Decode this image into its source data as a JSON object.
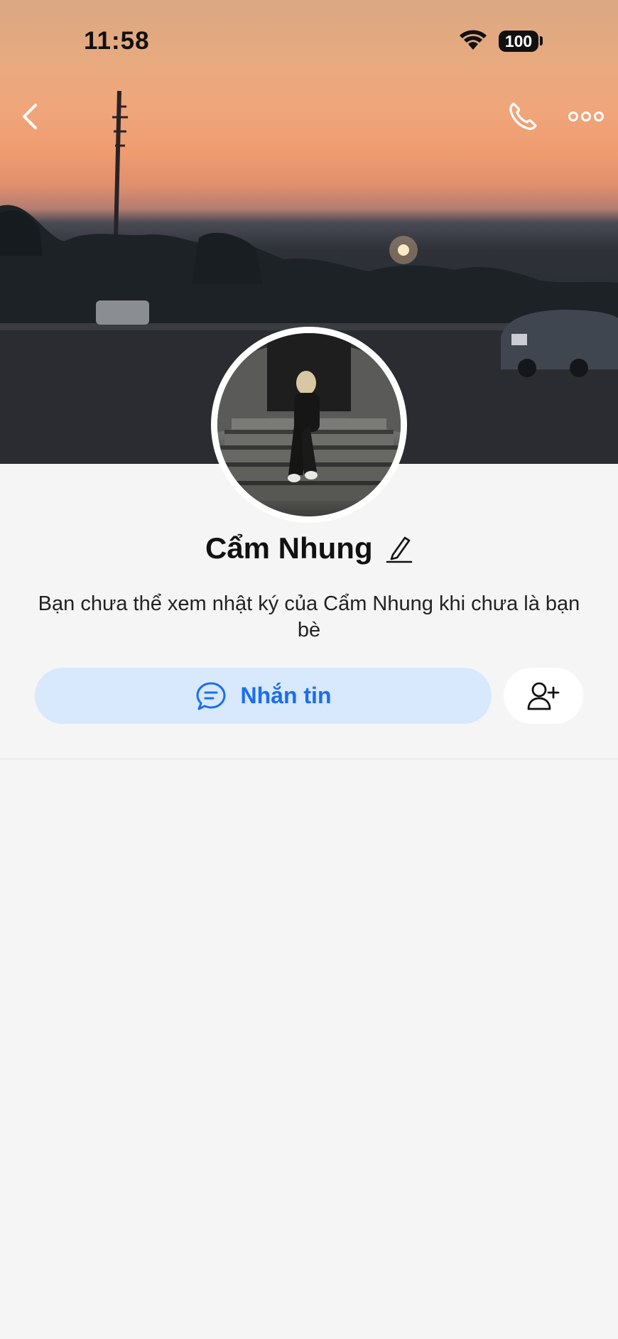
{
  "status_bar": {
    "time": "11:58",
    "battery": "100"
  },
  "header": {
    "back_icon": "chevron-left-icon",
    "call_icon": "phone-icon",
    "more_icon": "more-horizontal-icon"
  },
  "profile": {
    "name": "Cẩm Nhung",
    "edit_icon": "pencil-icon",
    "notice": "Bạn chưa thể xem nhật ký của Cẩm Nhung khi chưa là bạn bè"
  },
  "actions": {
    "message_label": "Nhắn tin",
    "message_icon": "chat-bubble-icon",
    "add_friend_icon": "add-user-icon",
    "accent": "#1a6ef0",
    "message_bg": "#d8e8fd"
  }
}
